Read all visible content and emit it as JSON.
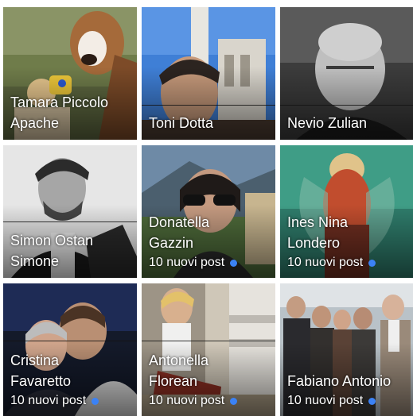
{
  "colors": {
    "new_post_dot": "#3b82f6"
  },
  "tiles": [
    {
      "name_line1": "Tamara Piccolo",
      "name_line2": "Apache",
      "posts": ""
    },
    {
      "name_line1": "Toni Dotta",
      "name_line2": "",
      "posts": ""
    },
    {
      "name_line1": "Nevio Zulian",
      "name_line2": "",
      "posts": ""
    },
    {
      "name_line1": "Simon Ostan",
      "name_line2": "Simone",
      "posts": ""
    },
    {
      "name_line1": "Donatella",
      "name_line2": "Gazzin",
      "posts": "10 nuovi post"
    },
    {
      "name_line1": "Ines Nina",
      "name_line2": "Londero",
      "posts": "10 nuovi post"
    },
    {
      "name_line1": "Cristina",
      "name_line2": "Favaretto",
      "posts": "10 nuovi post"
    },
    {
      "name_line1": "Antonella",
      "name_line2": "Florean",
      "posts": "10 nuovi post"
    },
    {
      "name_line1": "Fabiano Antonio",
      "name_line2": "",
      "posts": "10 nuovi post"
    }
  ]
}
